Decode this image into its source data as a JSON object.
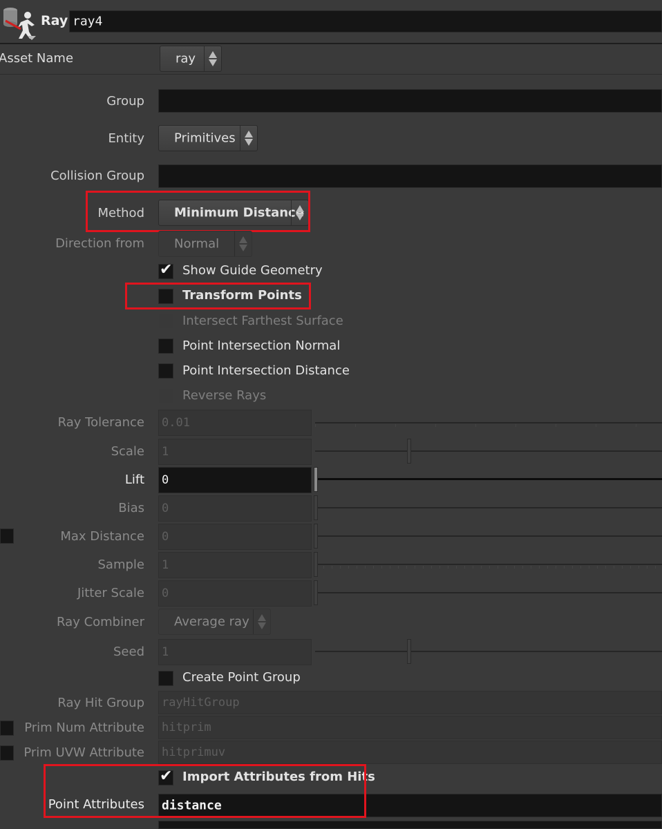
{
  "header": {
    "node_type": "Ray",
    "node_name": "ray4",
    "node_icon": "ray-node-icon"
  },
  "asset": {
    "label": "Asset Name",
    "value": "ray"
  },
  "params": {
    "group": {
      "label": "Group",
      "value": ""
    },
    "entity": {
      "label": "Entity",
      "value": "Primitives"
    },
    "collision_group": {
      "label": "Collision Group",
      "value": ""
    },
    "method": {
      "label": "Method",
      "value": "Minimum Distance"
    },
    "direction_from": {
      "label": "Direction from",
      "value": "Normal"
    },
    "show_guide": {
      "label": "Show Guide Geometry",
      "checked": true
    },
    "transform_points": {
      "label": "Transform Points",
      "checked": false
    },
    "intersect_farthest": {
      "label": "Intersect Farthest Surface",
      "checked": false
    },
    "point_intersection_normal": {
      "label": "Point Intersection Normal",
      "checked": false
    },
    "point_intersection_distance": {
      "label": "Point Intersection Distance",
      "checked": false
    },
    "reverse_rays": {
      "label": "Reverse Rays",
      "checked": false
    },
    "ray_tolerance": {
      "label": "Ray Tolerance",
      "value": "0.01"
    },
    "scale": {
      "label": "Scale",
      "value": "1"
    },
    "lift": {
      "label": "Lift",
      "value": "0"
    },
    "bias": {
      "label": "Bias",
      "value": "0"
    },
    "max_distance": {
      "label": "Max Distance",
      "value": "0"
    },
    "sample": {
      "label": "Sample",
      "value": "1"
    },
    "jitter_scale": {
      "label": "Jitter Scale",
      "value": "0"
    },
    "ray_combiner": {
      "label": "Ray Combiner",
      "value": "Average ray"
    },
    "seed": {
      "label": "Seed",
      "value": "1"
    },
    "create_point_group": {
      "label": "Create Point Group",
      "checked": false
    },
    "ray_hit_group": {
      "label": "Ray Hit Group",
      "value": "rayHitGroup"
    },
    "prim_num_attribute": {
      "label": "Prim Num Attribute",
      "value": "hitprim"
    },
    "prim_uvw_attribute": {
      "label": "Prim UVW Attribute",
      "value": "hitprimuv"
    },
    "import_attributes": {
      "label": "Import Attributes from Hits",
      "checked": true
    },
    "point_attributes": {
      "label": "Point Attributes",
      "value": "distance"
    }
  },
  "colors": {
    "background": "#3a3a3a",
    "field": "#141414",
    "highlight": "#e0141e"
  }
}
